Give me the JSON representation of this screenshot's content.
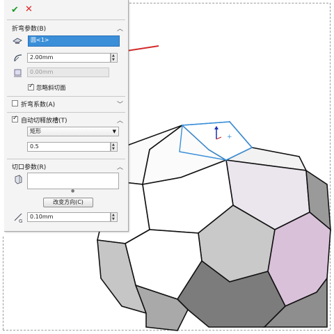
{
  "panel": {
    "confirm_icon": "green-check-icon",
    "cancel_icon": "red-x-icon",
    "bend_params": {
      "title": "折弯参数(B)",
      "fixed_face": "圆<1>",
      "radius": "2.00mm",
      "thickness": "0.00mm",
      "ignore_bevel_label": "忽略斜切面",
      "ignore_bevel_checked": true
    },
    "bend_factor": {
      "title": "折弯系数(A)",
      "checked": false
    },
    "auto_relief": {
      "title": "自动切释放槽(T)",
      "checked": true,
      "type": "矩形",
      "ratio": "0.5"
    },
    "rip_params": {
      "title": "切口参数(R)",
      "edges": "",
      "change_direction_label": "改变方向(C)",
      "gap": "0.10mm"
    }
  },
  "viewport": {
    "colors": {
      "face_white": "#ffffff",
      "face_gray": "#c9c9c9",
      "face_dark": "#7c7c7c",
      "face_pink": "#d9c2d9",
      "face_lavender": "#ebe6ee",
      "edge": "#111111",
      "selection": "#3a8fd8",
      "arrow": "#d42a2a"
    }
  }
}
